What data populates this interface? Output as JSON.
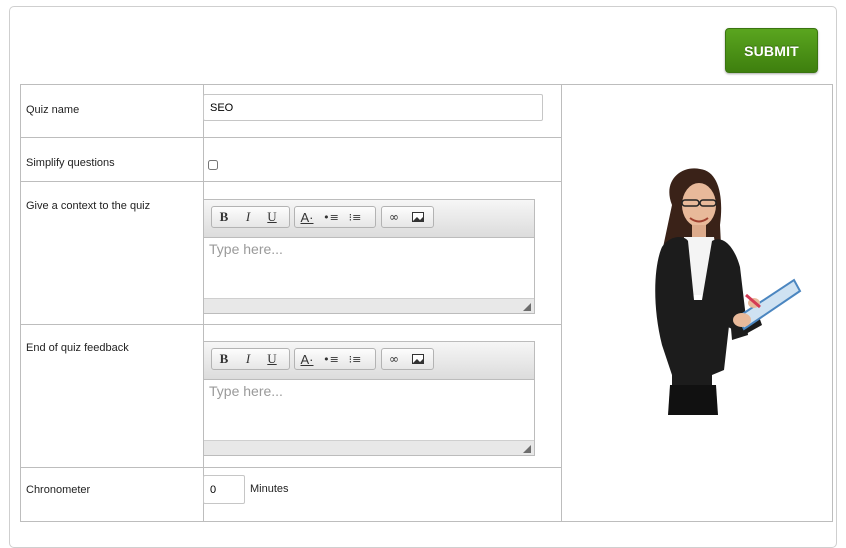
{
  "submit_label": "SUBMIT",
  "fields": {
    "quiz_name_label": "Quiz name",
    "quiz_name_value": "SEO",
    "simplify_label": "Simplify questions",
    "context_label": "Give a context to the quiz",
    "feedback_label": "End of quiz feedback",
    "chronometer_label": "Chronometer",
    "chronometer_value": "0",
    "minutes_label": "Minutes"
  },
  "editor": {
    "placeholder": "Type here...",
    "toolbar": [
      "bold-icon",
      "italic-icon",
      "underline-icon",
      "text-color-icon",
      "bullet-list-icon",
      "numbered-list-icon",
      "link-icon",
      "image-icon"
    ]
  },
  "colors": {
    "submit": "#4a8f16"
  }
}
